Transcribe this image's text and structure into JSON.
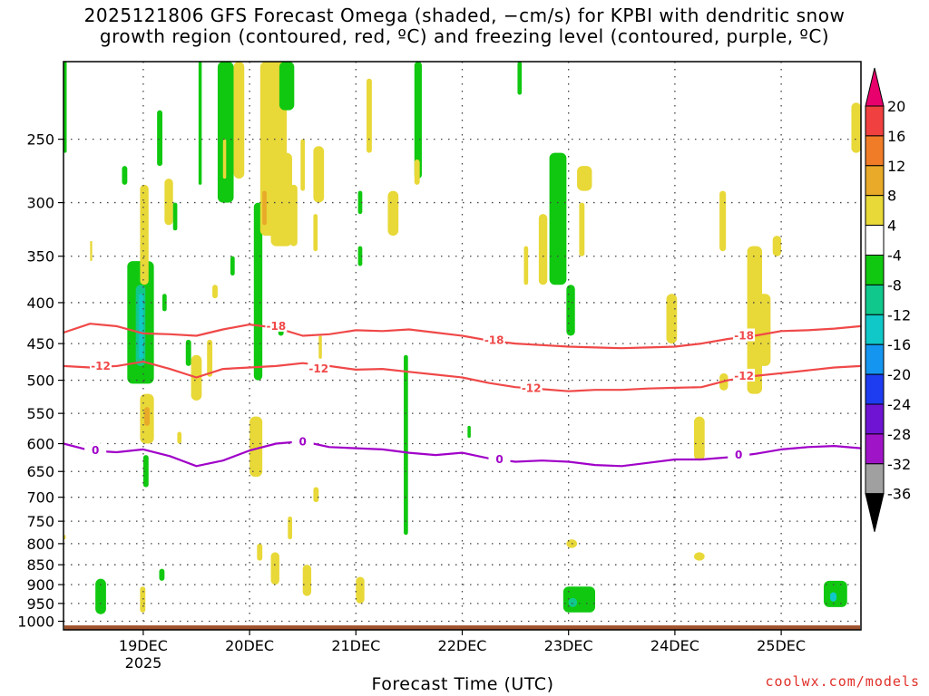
{
  "title": {
    "line1": "2025121806 GFS Forecast Omega (shaded, −cm/s) for KPBI with dendritic snow",
    "line2": "growth region (contoured, red, ºC) and freezing level (contoured, purple, ºC)"
  },
  "xlabel": "Forecast Time (UTC)",
  "credit": "coolwx.com/models",
  "year_label": "2025",
  "colors": {
    "dendritic_contour": "#f04848",
    "freezing_contour": "#a000c8",
    "ground": "#a0522d",
    "grid": "#444444"
  },
  "chart_data": {
    "type": "heatmap",
    "title": "2025121806 GFS Forecast Omega (shaded, −cm/s) for KPBI with dendritic snow growth region (contoured, red, ºC) and freezing level (contoured, purple, ºC)",
    "xlabel": "Forecast Time (UTC)",
    "ylabel": "",
    "x_ticks": [
      "19DEC",
      "20DEC",
      "21DEC",
      "22DEC",
      "23DEC",
      "24DEC",
      "25DEC"
    ],
    "x_range_days": [
      18.25,
      25.75
    ],
    "y_ticks": [
      250,
      300,
      350,
      400,
      450,
      500,
      550,
      600,
      650,
      700,
      750,
      800,
      850,
      900,
      950,
      1000
    ],
    "y_range_hpa": [
      200,
      1025
    ],
    "grid": true,
    "colorbar": {
      "levels": [
        20,
        16,
        12,
        8,
        4,
        -4,
        -8,
        -12,
        -16,
        -20,
        -24,
        -28,
        -32,
        -36
      ],
      "bins": [
        {
          "color": "#e8006c"
        },
        {
          "color": "#f04040"
        },
        {
          "color": "#f07c28"
        },
        {
          "color": "#e8aa28"
        },
        {
          "color": "#e8d838"
        },
        {
          "color": "#ffffff"
        },
        {
          "color": "#10c810"
        },
        {
          "color": "#10c88c"
        },
        {
          "color": "#10c8c8"
        },
        {
          "color": "#1496f0"
        },
        {
          "color": "#1e3cf0"
        },
        {
          "color": "#6e14d2"
        },
        {
          "color": "#a014c8"
        },
        {
          "color": "#a0a0a0"
        },
        {
          "color": "#000000"
        }
      ]
    },
    "contours": [
      {
        "level": "-18",
        "color": "#f04848",
        "x": [
          18.25,
          18.5,
          18.75,
          19.0,
          19.25,
          19.5,
          19.75,
          20.0,
          20.25,
          20.5,
          20.75,
          21.0,
          21.25,
          21.5,
          21.75,
          22.0,
          22.25,
          22.5,
          22.75,
          23.0,
          23.25,
          23.5,
          23.75,
          24.0,
          24.25,
          24.5,
          24.75,
          25.0,
          25.25,
          25.5,
          25.75
        ],
        "p": [
          436,
          425,
          428,
          437,
          438,
          440,
          432,
          426,
          430,
          440,
          438,
          433,
          434,
          432,
          436,
          440,
          446,
          450,
          452,
          454,
          455,
          456,
          455,
          454,
          450,
          444,
          440,
          434,
          433,
          431,
          428
        ],
        "labels": [
          {
            "x": 20.25,
            "p": 428
          },
          {
            "x": 22.3,
            "p": 446
          },
          {
            "x": 24.65,
            "p": 440
          }
        ]
      },
      {
        "level": "-12",
        "color": "#f04848",
        "x": [
          18.25,
          18.5,
          18.75,
          19.0,
          19.25,
          19.5,
          19.75,
          20.0,
          20.25,
          20.5,
          20.75,
          21.0,
          21.25,
          21.5,
          21.75,
          22.0,
          22.25,
          22.5,
          22.75,
          23.0,
          23.25,
          23.5,
          23.75,
          24.0,
          24.25,
          24.5,
          24.75,
          25.0,
          25.25,
          25.5,
          25.75
        ],
        "p": [
          480,
          482,
          480,
          474,
          484,
          496,
          484,
          482,
          480,
          476,
          480,
          485,
          484,
          488,
          492,
          496,
          504,
          510,
          513,
          516,
          514,
          514,
          512,
          511,
          510,
          500,
          494,
          490,
          486,
          482,
          480
        ],
        "labels": [
          {
            "x": 18.6,
            "p": 480
          },
          {
            "x": 20.65,
            "p": 484
          },
          {
            "x": 22.65,
            "p": 512
          },
          {
            "x": 24.65,
            "p": 494
          }
        ]
      },
      {
        "level": "0",
        "color": "#a000c8",
        "x": [
          18.25,
          18.5,
          18.75,
          19.0,
          19.25,
          19.5,
          19.75,
          20.0,
          20.25,
          20.5,
          20.75,
          21.0,
          21.25,
          21.5,
          21.75,
          22.0,
          22.25,
          22.5,
          22.75,
          23.0,
          23.25,
          23.5,
          23.75,
          24.0,
          24.25,
          24.5,
          24.75,
          25.0,
          25.25,
          25.5,
          25.75
        ],
        "p": [
          600,
          612,
          615,
          610,
          622,
          640,
          630,
          612,
          600,
          596,
          606,
          608,
          610,
          616,
          620,
          616,
          626,
          632,
          630,
          632,
          638,
          640,
          634,
          628,
          628,
          624,
          618,
          610,
          606,
          604,
          608
        ],
        "labels": [
          {
            "x": 18.55,
            "p": 612
          },
          {
            "x": 20.5,
            "p": 597
          },
          {
            "x": 22.35,
            "p": 628
          },
          {
            "x": 24.6,
            "p": 620
          }
        ]
      }
    ],
    "shaded_regions": [
      {
        "value": -6,
        "x0": 18.25,
        "x1": 18.28,
        "p0": 200,
        "p1": 260
      },
      {
        "value": 6,
        "x0": 18.25,
        "x1": 18.27,
        "p0": 780,
        "p1": 790
      },
      {
        "value": 6,
        "x0": 18.5,
        "x1": 18.52,
        "p0": 335,
        "p1": 355
      },
      {
        "value": -6,
        "x0": 18.55,
        "x1": 18.65,
        "p0": 885,
        "p1": 980
      },
      {
        "value": -6,
        "x0": 18.8,
        "x1": 18.85,
        "p0": 270,
        "p1": 285
      },
      {
        "value": -6,
        "x0": 18.85,
        "x1": 19.1,
        "p0": 355,
        "p1": 505
      },
      {
        "value": -10,
        "x0": 18.93,
        "x1": 19.02,
        "p0": 380,
        "p1": 480
      },
      {
        "value": -14,
        "x0": 18.96,
        "x1": 19.0,
        "p0": 390,
        "p1": 470
      },
      {
        "value": 6,
        "x0": 18.97,
        "x1": 19.05,
        "p0": 285,
        "p1": 380
      },
      {
        "value": 6,
        "x0": 18.97,
        "x1": 19.1,
        "p0": 520,
        "p1": 600
      },
      {
        "value": 10,
        "x0": 19.01,
        "x1": 19.06,
        "p0": 540,
        "p1": 570
      },
      {
        "value": -6,
        "x0": 19.0,
        "x1": 19.05,
        "p0": 620,
        "p1": 680
      },
      {
        "value": -6,
        "x0": 19.13,
        "x1": 19.18,
        "p0": 230,
        "p1": 270
      },
      {
        "value": -6,
        "x0": 19.15,
        "x1": 19.2,
        "p0": 860,
        "p1": 890
      },
      {
        "value": 6,
        "x0": 18.97,
        "x1": 19.02,
        "p0": 905,
        "p1": 975
      },
      {
        "value": -6,
        "x0": 19.18,
        "x1": 19.22,
        "p0": 390,
        "p1": 410
      },
      {
        "value": 6,
        "x0": 19.2,
        "x1": 19.28,
        "p0": 280,
        "p1": 320
      },
      {
        "value": -6,
        "x0": 19.28,
        "x1": 19.32,
        "p0": 300,
        "p1": 325
      },
      {
        "value": 6,
        "x0": 19.32,
        "x1": 19.36,
        "p0": 580,
        "p1": 600
      },
      {
        "value": -6,
        "x0": 19.4,
        "x1": 19.45,
        "p0": 445,
        "p1": 480
      },
      {
        "value": 6,
        "x0": 19.45,
        "x1": 19.55,
        "p0": 465,
        "p1": 530
      },
      {
        "value": -6,
        "x0": 19.52,
        "x1": 19.55,
        "p0": 200,
        "p1": 285
      },
      {
        "value": 6,
        "x0": 19.6,
        "x1": 19.65,
        "p0": 445,
        "p1": 495
      },
      {
        "value": -6,
        "x0": 19.7,
        "x1": 19.85,
        "p0": 200,
        "p1": 300
      },
      {
        "value": 6,
        "x0": 19.75,
        "x1": 19.78,
        "p0": 250,
        "p1": 280
      },
      {
        "value": 6,
        "x0": 19.65,
        "x1": 19.7,
        "p0": 380,
        "p1": 395
      },
      {
        "value": -6,
        "x0": 19.82,
        "x1": 19.86,
        "p0": 350,
        "p1": 370
      },
      {
        "value": -6,
        "x0": 20.04,
        "x1": 20.12,
        "p0": 300,
        "p1": 500
      },
      {
        "value": -6,
        "x0": 20.05,
        "x1": 20.08,
        "p0": 580,
        "p1": 610
      },
      {
        "value": 6,
        "x0": 20.0,
        "x1": 20.12,
        "p0": 555,
        "p1": 660
      },
      {
        "value": 6,
        "x0": 20.07,
        "x1": 20.12,
        "p0": 800,
        "p1": 840
      },
      {
        "value": 6,
        "x0": 19.85,
        "x1": 19.95,
        "p0": 200,
        "p1": 280
      },
      {
        "value": 6,
        "x0": 20.1,
        "x1": 20.35,
        "p0": 200,
        "p1": 330
      },
      {
        "value": 10,
        "x0": 20.12,
        "x1": 20.16,
        "p0": 290,
        "p1": 320
      },
      {
        "value": 6,
        "x0": 20.2,
        "x1": 20.4,
        "p0": 260,
        "p1": 340
      },
      {
        "value": -6,
        "x0": 20.28,
        "x1": 20.42,
        "p0": 200,
        "p1": 230
      },
      {
        "value": 6,
        "x0": 20.38,
        "x1": 20.45,
        "p0": 285,
        "p1": 340
      },
      {
        "value": 6,
        "x0": 20.48,
        "x1": 20.52,
        "p0": 250,
        "p1": 290
      },
      {
        "value": 6,
        "x0": 20.6,
        "x1": 20.7,
        "p0": 255,
        "p1": 300
      },
      {
        "value": -6,
        "x0": 20.27,
        "x1": 20.32,
        "p0": 420,
        "p1": 440
      },
      {
        "value": 6,
        "x0": 20.6,
        "x1": 20.64,
        "p0": 310,
        "p1": 345
      },
      {
        "value": 6,
        "x0": 20.65,
        "x1": 20.68,
        "p0": 440,
        "p1": 470
      },
      {
        "value": 6,
        "x0": 20.2,
        "x1": 20.28,
        "p0": 820,
        "p1": 900
      },
      {
        "value": 6,
        "x0": 20.36,
        "x1": 20.4,
        "p0": 740,
        "p1": 790
      },
      {
        "value": 6,
        "x0": 20.5,
        "x1": 20.58,
        "p0": 850,
        "p1": 930
      },
      {
        "value": 6,
        "x0": 20.6,
        "x1": 20.65,
        "p0": 680,
        "p1": 710
      },
      {
        "value": -6,
        "x0": 21.02,
        "x1": 21.06,
        "p0": 290,
        "p1": 310
      },
      {
        "value": -6,
        "x0": 21.02,
        "x1": 21.06,
        "p0": 340,
        "p1": 360
      },
      {
        "value": 6,
        "x0": 21.0,
        "x1": 21.08,
        "p0": 880,
        "p1": 950
      },
      {
        "value": 6,
        "x0": 21.1,
        "x1": 21.15,
        "p0": 210,
        "p1": 260
      },
      {
        "value": 6,
        "x0": 21.3,
        "x1": 21.4,
        "p0": 290,
        "p1": 330
      },
      {
        "value": -6,
        "x0": 21.45,
        "x1": 21.49,
        "p0": 465,
        "p1": 780
      },
      {
        "value": -6,
        "x0": 21.55,
        "x1": 21.62,
        "p0": 200,
        "p1": 280
      },
      {
        "value": 6,
        "x0": 21.55,
        "x1": 21.6,
        "p0": 265,
        "p1": 285
      },
      {
        "value": -6,
        "x0": 22.05,
        "x1": 22.08,
        "p0": 570,
        "p1": 590
      },
      {
        "value": -6,
        "x0": 22.52,
        "x1": 22.56,
        "p0": 200,
        "p1": 220
      },
      {
        "value": 6,
        "x0": 22.58,
        "x1": 22.62,
        "p0": 340,
        "p1": 380
      },
      {
        "value": 6,
        "x0": 22.72,
        "x1": 22.8,
        "p0": 310,
        "p1": 380
      },
      {
        "value": 6,
        "x0": 22.98,
        "x1": 23.08,
        "p0": 790,
        "p1": 810
      },
      {
        "value": -6,
        "x0": 22.82,
        "x1": 22.98,
        "p0": 260,
        "p1": 380
      },
      {
        "value": -6,
        "x0": 22.98,
        "x1": 23.06,
        "p0": 380,
        "p1": 440
      },
      {
        "value": 6,
        "x0": 23.08,
        "x1": 23.22,
        "p0": 270,
        "p1": 290
      },
      {
        "value": 6,
        "x0": 23.1,
        "x1": 23.15,
        "p0": 300,
        "p1": 350
      },
      {
        "value": -6,
        "x0": 22.95,
        "x1": 23.25,
        "p0": 905,
        "p1": 975
      },
      {
        "value": -10,
        "x0": 23.0,
        "x1": 23.08,
        "p0": 935,
        "p1": 960
      },
      {
        "value": 6,
        "x0": 23.92,
        "x1": 24.02,
        "p0": 390,
        "p1": 450
      },
      {
        "value": 6,
        "x0": 24.18,
        "x1": 24.28,
        "p0": 555,
        "p1": 630
      },
      {
        "value": 6,
        "x0": 24.18,
        "x1": 24.28,
        "p0": 820,
        "p1": 840
      },
      {
        "value": 6,
        "x0": 24.42,
        "x1": 24.48,
        "p0": 290,
        "p1": 345
      },
      {
        "value": 6,
        "x0": 24.42,
        "x1": 24.5,
        "p0": 490,
        "p1": 515
      },
      {
        "value": 6,
        "x0": 24.68,
        "x1": 24.82,
        "p0": 340,
        "p1": 520
      },
      {
        "value": 6,
        "x0": 24.78,
        "x1": 24.9,
        "p0": 390,
        "p1": 480
      },
      {
        "value": 6,
        "x0": 24.92,
        "x1": 25.0,
        "p0": 330,
        "p1": 350
      },
      {
        "value": -6,
        "x0": 25.4,
        "x1": 25.62,
        "p0": 890,
        "p1": 960
      },
      {
        "value": -14,
        "x0": 25.46,
        "x1": 25.52,
        "p0": 920,
        "p1": 945
      },
      {
        "value": 6,
        "x0": 25.66,
        "x1": 25.75,
        "p0": 225,
        "p1": 260
      }
    ]
  }
}
